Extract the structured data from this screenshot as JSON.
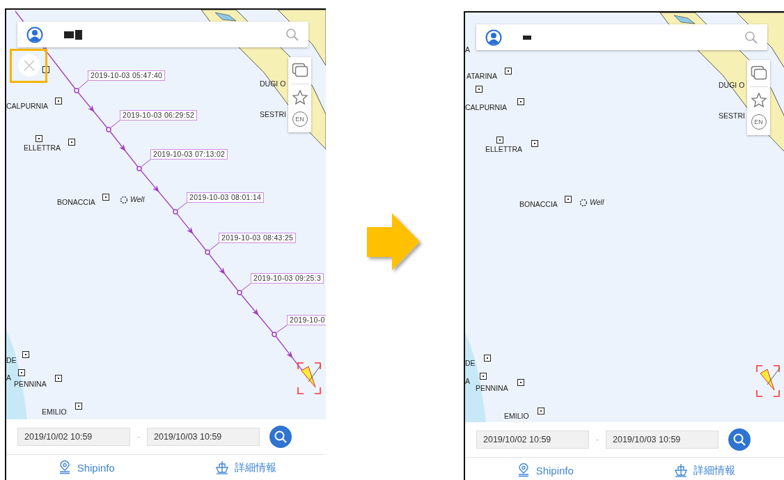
{
  "panels": [
    {
      "close_button": {
        "highlighted": true
      },
      "map_labels": [
        {
          "text": "CALPURNIA",
          "kind": "name"
        },
        {
          "text": "ELLETTRA",
          "kind": "name"
        },
        {
          "text": "BONACCIA",
          "kind": "name"
        },
        {
          "text": "Well",
          "kind": "well"
        },
        {
          "text": "DE",
          "kind": "name"
        },
        {
          "text": "A",
          "kind": "name"
        },
        {
          "text": "PENNINA",
          "kind": "name"
        },
        {
          "text": "EMILIO",
          "kind": "name"
        },
        {
          "text": "DUGI O",
          "kind": "name"
        },
        {
          "text": "SESTRI",
          "kind": "name"
        }
      ],
      "track": [
        "2019-10-03 05:47:40",
        "2019-10-03 06:29:52",
        "2019-10-03 07:13:02",
        "2019-10-03 08:01:14",
        "2019-10-03 08:43:25",
        "2019-10-03 09:25:3",
        "2019-10-0"
      ],
      "side_toolbar": {
        "language": "EN"
      },
      "date_from": "2019/10/02 10:59",
      "date_separator": "-",
      "date_to": "2019/10/03 10:59",
      "tabs": [
        {
          "label": "Shipinfo",
          "kind": "pin"
        },
        {
          "label": "詳細情報",
          "kind": "ship"
        }
      ]
    },
    {
      "map_labels": [
        {
          "text": "A",
          "kind": "name"
        },
        {
          "text": "ATARINA",
          "kind": "name"
        },
        {
          "text": "CALPURNIA",
          "kind": "name"
        },
        {
          "text": "ELLETTRA",
          "kind": "name"
        },
        {
          "text": "BONACCIA",
          "kind": "name"
        },
        {
          "text": "Well",
          "kind": "well"
        },
        {
          "text": "DE",
          "kind": "name"
        },
        {
          "text": "A",
          "kind": "name"
        },
        {
          "text": "PENNINA",
          "kind": "name"
        },
        {
          "text": "EMILIO",
          "kind": "name"
        },
        {
          "text": "DUGI O",
          "kind": "name"
        },
        {
          "text": "SESTRI",
          "kind": "name"
        }
      ],
      "side_toolbar": {
        "language": "EN"
      },
      "date_from": "2019/10/02 10:59",
      "date_separator": "-",
      "date_to": "2019/10/03 10:59",
      "tabs": [
        {
          "label": "Shipinfo",
          "kind": "pin"
        },
        {
          "label": "詳細情報",
          "kind": "ship"
        }
      ]
    }
  ]
}
